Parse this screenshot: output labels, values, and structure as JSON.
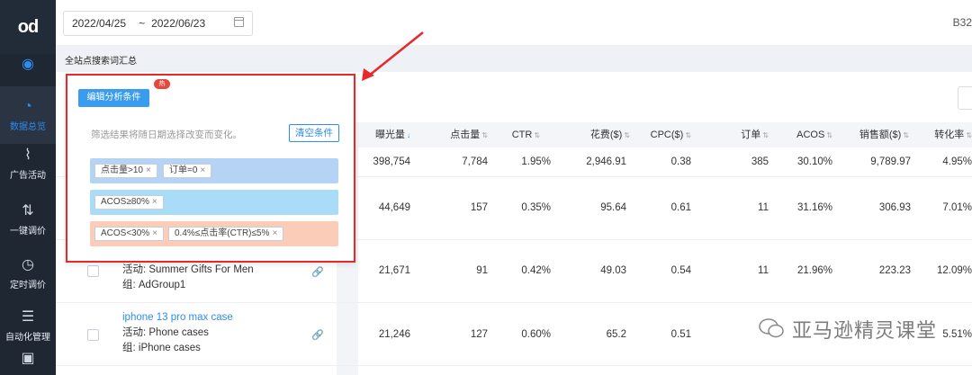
{
  "sidebar": {
    "logo": "od",
    "items": [
      {
        "label": "",
        "icon": "target-icon"
      },
      {
        "label": "数据总览",
        "icon": "pie-chart-icon",
        "active": true
      },
      {
        "label": "广告活动",
        "icon": "line-chart-icon"
      },
      {
        "label": "一键调价",
        "icon": "sort-icon"
      },
      {
        "label": "定时调价",
        "icon": "clock-icon"
      },
      {
        "label": "自动化管理",
        "icon": "sliders-icon"
      },
      {
        "label": "",
        "icon": "calendar-icon"
      }
    ]
  },
  "topbar": {
    "date_start": "2022/04/25",
    "date_sep": "~",
    "date_end": "2022/06/23",
    "right_text": "B32"
  },
  "section": {
    "title": "全站点搜索词汇总"
  },
  "filter": {
    "edit_button": "编辑分析条件",
    "hot_badge": "热",
    "hint": "筛选结果将随日期选择改变而变化。",
    "clear_button": "清空条件",
    "groups": [
      {
        "tags": [
          "点击量>10",
          "订单=0"
        ]
      },
      {
        "tags": [
          "ACOS≥80%"
        ]
      },
      {
        "tags": [
          "ACOS<30%",
          "0.4%≤点击率(CTR)≤5%"
        ]
      }
    ],
    "tag_close": "×"
  },
  "table": {
    "columns": [
      {
        "label": "曝光量",
        "sort": "↓"
      },
      {
        "label": "点击量",
        "sort": "⇅"
      },
      {
        "label": "CTR",
        "sort": "⇅"
      },
      {
        "label": "花费($)",
        "sort": "⇅"
      },
      {
        "label": "CPC($)",
        "sort": "⇅"
      },
      {
        "label": "订单",
        "sort": "⇅"
      },
      {
        "label": "ACOS",
        "sort": "⇅"
      },
      {
        "label": "销售额($)",
        "sort": "⇅"
      },
      {
        "label": "转化率",
        "sort": "⇅"
      }
    ],
    "rows": [
      {
        "keyword": "",
        "campaign": "",
        "group": "",
        "values": [
          "398,754",
          "7,784",
          "1.95%",
          "2,946.91",
          "0.38",
          "385",
          "30.10%",
          "9,789.97",
          "4.95%"
        ]
      },
      {
        "keyword": "",
        "campaign": "",
        "group": "",
        "values": [
          "44,649",
          "157",
          "0.35%",
          "95.64",
          "0.61",
          "11",
          "31.16%",
          "306.93",
          "7.01%"
        ]
      },
      {
        "keyword": "",
        "campaign": "活动: Summer Gifts For Men",
        "group": "组: AdGroup1",
        "values": [
          "21,671",
          "91",
          "0.42%",
          "49.03",
          "0.54",
          "11",
          "21.96%",
          "223.23",
          "12.09%"
        ]
      },
      {
        "keyword": "iphone 13 pro max case",
        "campaign": "活动: Phone cases",
        "group": "组: iPhone cases",
        "values": [
          "21,246",
          "127",
          "0.60%",
          "65.2",
          "0.51",
          "",
          "",
          "",
          "5.51%"
        ]
      }
    ]
  },
  "watermark": "亚马逊精灵课堂",
  "colors": {
    "accent": "#2d8cf0",
    "highlight": "#e8282b",
    "sidebar": "#1f2733"
  }
}
